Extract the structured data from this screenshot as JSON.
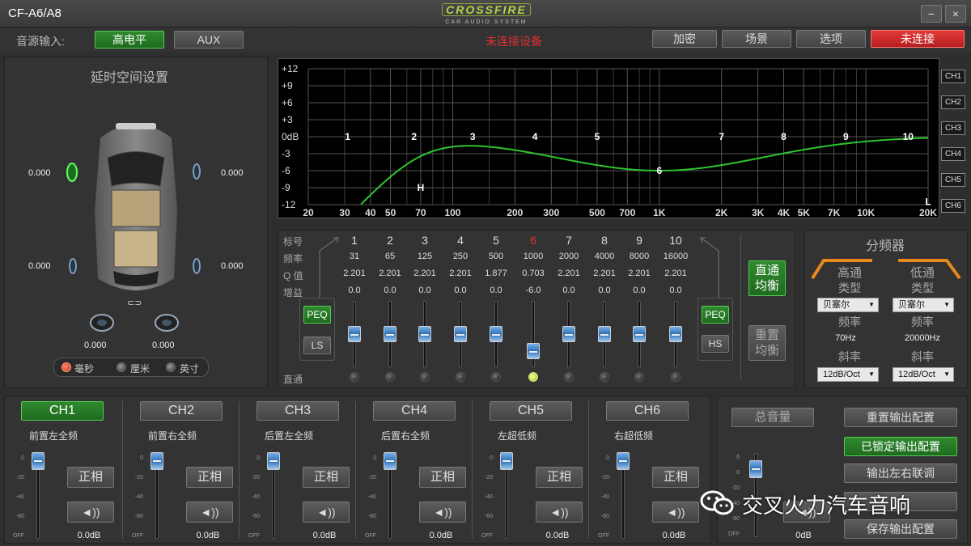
{
  "window": {
    "title": "CF-A6/A8",
    "logo_main": "CROSSFIRE",
    "logo_sub": "CAR AUDIO SYSTEM",
    "minimize": "−",
    "close": "×"
  },
  "toolbar": {
    "source_label": "音源输入:",
    "source_high": "高电平",
    "source_aux": "AUX",
    "device_status": "未连接设备",
    "encrypt": "加密",
    "scene": "场景",
    "options": "选项",
    "connect": "未连接"
  },
  "delay_panel": {
    "title": "延时空间设置",
    "front_left": "0.000",
    "front_right": "0.000",
    "rear_left": "0.000",
    "rear_right": "0.000",
    "sub_left": "0.000",
    "sub_right": "0.000",
    "link_icon": "⊂⊃",
    "unit_ms": "毫秒",
    "unit_cm": "厘米",
    "unit_inch": "英寸"
  },
  "eq_graph": {
    "y_ticks": [
      "+12",
      "+9",
      "+6",
      "+3",
      "0dB",
      "-3",
      "-6",
      "-9",
      "-12"
    ],
    "x_ticks": [
      "20",
      "30",
      "40",
      "50",
      "70",
      "100",
      "200",
      "300",
      "500",
      "700",
      "1K",
      "2K",
      "3K",
      "4K",
      "5K",
      "7K",
      "10K",
      "20K"
    ],
    "band_markers": [
      "1",
      "2",
      "3",
      "4",
      "5",
      "6",
      "7",
      "8",
      "9",
      "10"
    ],
    "hp_marker": "H",
    "lp_marker": "L",
    "channels": [
      "CH1",
      "CH2",
      "CH3",
      "CH4",
      "CH5",
      "CH6"
    ]
  },
  "eq_table": {
    "row_labels": [
      "标号",
      "频率",
      "Q 值",
      "增益"
    ],
    "bands": [
      {
        "id": "1",
        "freq": "31",
        "q": "2.201",
        "gain": "0.0",
        "level": 0.5
      },
      {
        "id": "2",
        "freq": "65",
        "q": "2.201",
        "gain": "0.0",
        "level": 0.5
      },
      {
        "id": "3",
        "freq": "125",
        "q": "2.201",
        "gain": "0.0",
        "level": 0.5
      },
      {
        "id": "4",
        "freq": "250",
        "q": "2.201",
        "gain": "0.0",
        "level": 0.5
      },
      {
        "id": "5",
        "freq": "500",
        "q": "1.877",
        "gain": "0.0",
        "level": 0.5
      },
      {
        "id": "6",
        "freq": "1000",
        "q": "0.703",
        "gain": "-6.0",
        "level": 0.25
      },
      {
        "id": "7",
        "freq": "2000",
        "q": "2.201",
        "gain": "0.0",
        "level": 0.5
      },
      {
        "id": "8",
        "freq": "4000",
        "q": "2.201",
        "gain": "0.0",
        "level": 0.5
      },
      {
        "id": "9",
        "freq": "8000",
        "q": "2.201",
        "gain": "0.0",
        "level": 0.5
      },
      {
        "id": "10",
        "freq": "16000",
        "q": "2.201",
        "gain": "0.0",
        "level": 0.5
      }
    ],
    "bypass_label": "直通",
    "peq_left": "PEQ",
    "ls": "LS",
    "peq_right": "PEQ",
    "hs": "HS",
    "flat_eq_1": "直通",
    "flat_eq_2": "均衡",
    "reset_eq_1": "重置",
    "reset_eq_2": "均衡"
  },
  "crossover": {
    "title": "分频器",
    "hp_title": "高通",
    "lp_title": "低通",
    "type_label": "类型",
    "hp_type": "贝塞尔",
    "lp_type": "贝塞尔",
    "freq_label": "频率",
    "hp_freq": "70Hz",
    "lp_freq": "20000Hz",
    "slope_label": "斜率",
    "hp_slope": "12dB/Oct",
    "lp_slope": "12dB/Oct"
  },
  "channels": [
    {
      "tab": "CH1",
      "name": "前置左全频",
      "phase": "正相",
      "value": "0.0dB",
      "level": 0.95
    },
    {
      "tab": "CH2",
      "name": "前置右全频",
      "phase": "正相",
      "value": "0.0dB",
      "level": 0.95
    },
    {
      "tab": "CH3",
      "name": "后置左全频",
      "phase": "正相",
      "value": "0.0dB",
      "level": 0.95
    },
    {
      "tab": "CH4",
      "name": "后置右全频",
      "phase": "正相",
      "value": "0.0dB",
      "level": 0.95
    },
    {
      "tab": "CH5",
      "name": "左超低频",
      "phase": "正相",
      "value": "0.0dB",
      "level": 0.95
    },
    {
      "tab": "CH6",
      "name": "右超低频",
      "phase": "正相",
      "value": "0.0dB",
      "level": 0.95
    }
  ],
  "channel_scale": [
    "0",
    "-20",
    "-40",
    "-60",
    "OFF"
  ],
  "master": {
    "title": "总音量",
    "value": "0dB",
    "level": 0.86,
    "scale": [
      "6",
      "0",
      "-20",
      "-40",
      "-60",
      "OFF"
    ]
  },
  "output_config": {
    "reset": "重置输出配置",
    "locked": "已锁定输出配置",
    "link_lr": "输出左右联调",
    "save": "保存输出配置"
  },
  "watermark": "交叉火力汽车音响"
}
